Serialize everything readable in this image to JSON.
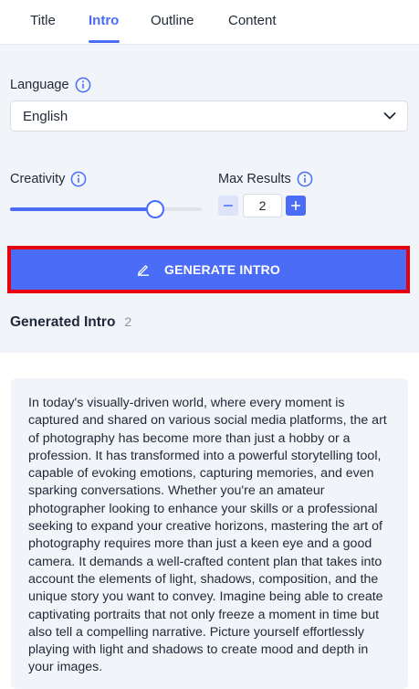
{
  "tabs": [
    {
      "label": "Title",
      "active": false
    },
    {
      "label": "Intro",
      "active": true
    },
    {
      "label": "Outline",
      "active": false
    },
    {
      "label": "Content",
      "active": false
    }
  ],
  "language": {
    "label": "Language",
    "selected": "English",
    "icon": "info-icon"
  },
  "creativity": {
    "label": "Creativity",
    "level_fraction": 0.75,
    "icon": "info-icon"
  },
  "max_results": {
    "label": "Max Results",
    "value": "2",
    "minus_symbol": "−",
    "plus_symbol": "+",
    "icon": "info-icon"
  },
  "generate": {
    "label": "GENERATE INTRO",
    "icon": "pencil-icon"
  },
  "results": {
    "title": "Generated Intro",
    "count": "2",
    "text": "In today's visually-driven world, where every moment is captured and shared on various social media platforms, the art of photography has become more than just a hobby or a profession. It has transformed into a powerful storytelling tool, capable of evoking emotions, capturing memories, and even sparking conversations. Whether you're an amateur photographer looking to enhance your skills or a professional seeking to expand your creative horizons, mastering the art of photography requires more than just a keen eye and a good camera. It demands a well-crafted content plan that takes into account the elements of light, shadows, composition, and the unique story you want to convey. Imagine being able to create captivating portraits that not only freeze a moment in time but also tell a compelling narrative. Picture yourself effortlessly playing with light and shadows to create mood and depth in your images."
  },
  "colors": {
    "accent": "#4a6cf7",
    "highlight_border": "#e8000e",
    "panel_bg": "#f1f4f9"
  }
}
